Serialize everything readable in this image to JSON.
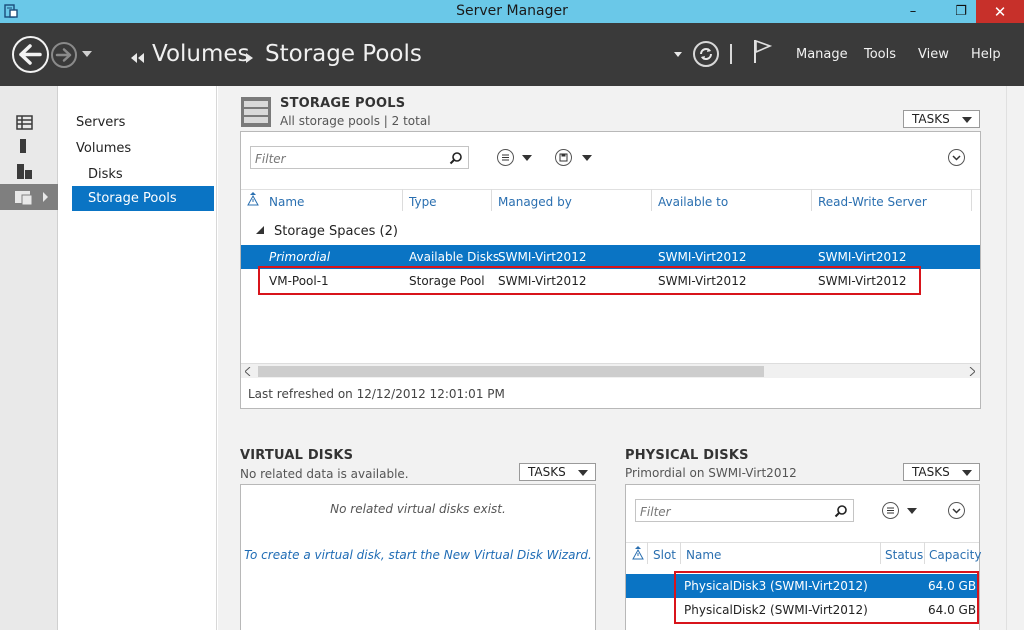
{
  "window": {
    "title": "Server Manager",
    "controls": {
      "minimize": "–",
      "restore": "❐",
      "close": "✕"
    }
  },
  "header": {
    "breadcrumb": [
      "Volumes",
      "Storage Pools"
    ],
    "menus": [
      "Manage",
      "Tools",
      "View",
      "Help"
    ]
  },
  "nav": {
    "items": [
      {
        "label": "Servers"
      },
      {
        "label": "Volumes"
      },
      {
        "label": "Disks"
      },
      {
        "label": "Storage Pools",
        "active": true
      }
    ]
  },
  "storage_pools": {
    "title": "STORAGE POOLS",
    "subtitle": "All storage pools | 2 total",
    "tasks_label": "TASKS",
    "filter_placeholder": "Filter",
    "columns": [
      "Name",
      "Type",
      "Managed by",
      "Available to",
      "Read-Write Server"
    ],
    "group_label": "Storage Spaces (2)",
    "rows": [
      {
        "name": "Primordial",
        "type": "Available Disks",
        "managed_by": "SWMI-Virt2012",
        "available_to": "SWMI-Virt2012",
        "rw_server": "SWMI-Virt2012",
        "selected": true
      },
      {
        "name": "VM-Pool-1",
        "type": "Storage Pool",
        "managed_by": "SWMI-Virt2012",
        "available_to": "SWMI-Virt2012",
        "rw_server": "SWMI-Virt2012",
        "selected": false
      }
    ],
    "last_refreshed": "Last refreshed on 12/12/2012 12:01:01 PM"
  },
  "virtual_disks": {
    "title": "VIRTUAL DISKS",
    "subtitle": "No related data is available.",
    "tasks_label": "TASKS",
    "empty_message": "No related virtual disks exist.",
    "wizard_link": "To create a virtual disk, start the New Virtual Disk Wizard."
  },
  "physical_disks": {
    "title": "PHYSICAL DISKS",
    "subtitle": "Primordial on SWMI-Virt2012",
    "tasks_label": "TASKS",
    "filter_placeholder": "Filter",
    "columns": [
      "Slot",
      "Name",
      "Status",
      "Capacity"
    ],
    "rows": [
      {
        "name": "PhysicalDisk3 (SWMI-Virt2012)",
        "capacity": "64.0 GB",
        "selected": true
      },
      {
        "name": "PhysicalDisk2 (SWMI-Virt2012)",
        "capacity": "64.0 GB",
        "selected": false
      }
    ]
  },
  "colors": {
    "titlebar": "#6ac8e8",
    "header": "#3a3a3a",
    "selection": "#0a74c4",
    "highlight_box": "#d8141b",
    "close_button": "#c7302a"
  }
}
